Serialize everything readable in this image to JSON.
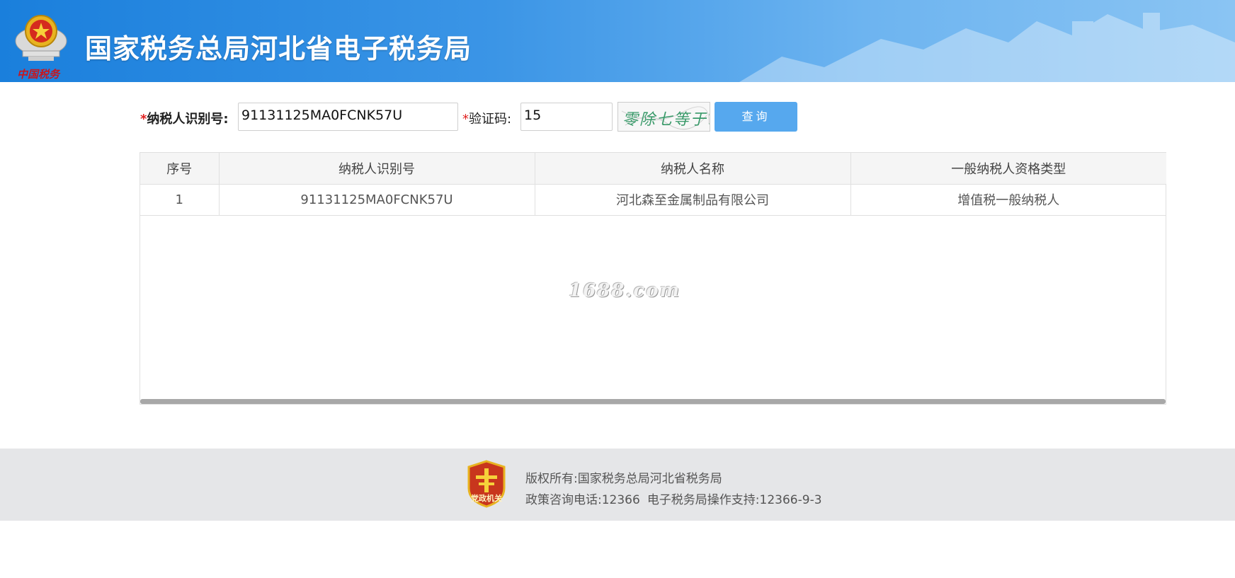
{
  "header": {
    "title": "国家税务总局河北省电子税务局",
    "logo_text": "中国税务",
    "bg_color": "#3b95e6"
  },
  "search": {
    "taxpayer_id_label": "纳税人识别号:",
    "taxpayer_id_value": "91131125MA0FCNK57U",
    "captcha_label": "验证码:",
    "captcha_value": "15",
    "captcha_image_text": "零除七等于?",
    "query_button": "查询",
    "required_mark": "*",
    "button_color": "#56a8ee"
  },
  "table": {
    "columns": [
      "序号",
      "纳税人识别号",
      "纳税人名称",
      "一般纳税人资格类型"
    ],
    "rows": [
      [
        "1",
        "91131125MA0FCNK57U",
        "河北森至金属制品有限公司",
        "增值税一般纳税人"
      ]
    ],
    "watermark": "1688.com"
  },
  "footer": {
    "badge_text": "党政机关",
    "copyright": "版权所有:国家税务总局河北省税务局",
    "hotline": "政策咨询电话:12366",
    "support": "电子税务局操作支持:12366-9-3"
  }
}
